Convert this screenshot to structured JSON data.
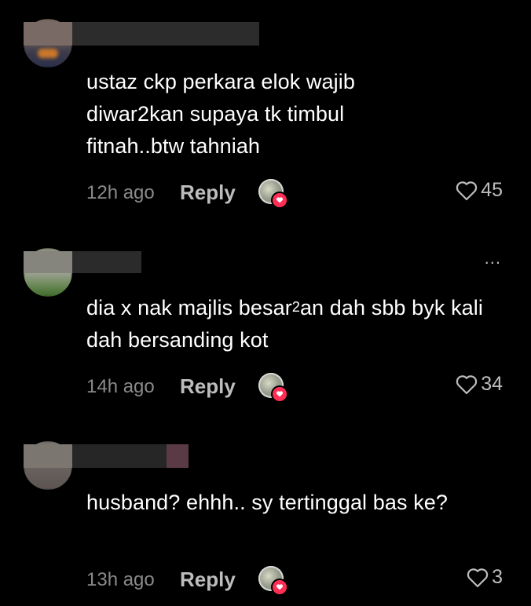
{
  "comments": [
    {
      "text": "ustaz ckp perkara elok wajib diwar2kan supaya tk timbul fitnah..btw tahniah",
      "time": "12h ago",
      "reply_label": "Reply",
      "likes": "45"
    },
    {
      "text_before": "dia x nak majlis besar",
      "text_sup": "2",
      "text_after": "an dah sbb byk kali dah bersanding kot",
      "time": "14h ago",
      "reply_label": "Reply",
      "likes": "34",
      "more_label": "..."
    },
    {
      "text": "husband? ehhh.. sy tertinggal bas ke?",
      "time": "13h ago",
      "reply_label": "Reply",
      "likes": "3"
    }
  ],
  "icons": {
    "like": "heart-outline-icon",
    "creator_liked": "creator-heart-badge-icon",
    "more": "more-options-icon"
  },
  "colors": {
    "background": "#000000",
    "text": "#ffffff",
    "secondary": "#8a8a8a",
    "like_badge": "#ff2e55"
  }
}
